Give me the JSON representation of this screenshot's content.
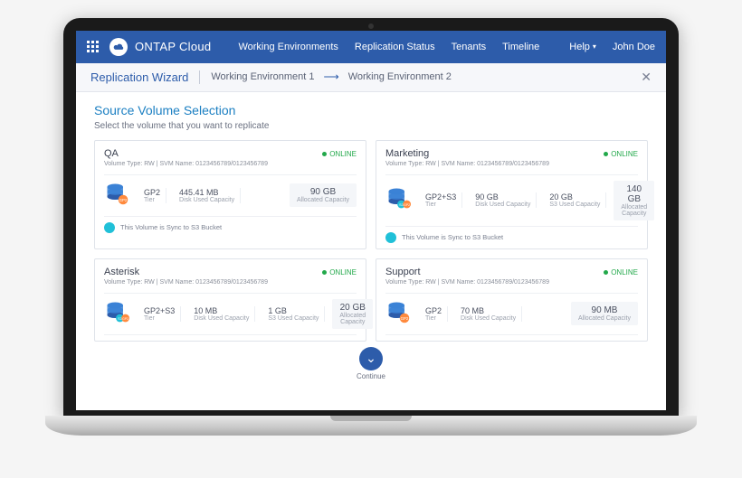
{
  "brand": "ONTAP Cloud",
  "nav": {
    "items": [
      "Working Environments",
      "Replication Status",
      "Tenants",
      "Timeline"
    ],
    "help": "Help",
    "user": "John Doe"
  },
  "wizard": {
    "title": "Replication Wizard",
    "env1": "Working Environment 1",
    "env2": "Working Environment 2"
  },
  "section": {
    "title": "Source Volume Selection",
    "subtitle": "Select the volume that you want to replicate"
  },
  "volumes": [
    {
      "name": "QA",
      "meta": "Volume Type: RW   |   SVM Name: 0123456789/0123456789",
      "status": "ONLINE",
      "tier": "GP2",
      "tier_label": "Tier",
      "metrics": [
        {
          "val": "445.41 MB",
          "lab": "Disk Used Capacity"
        }
      ],
      "alloc": {
        "val": "90 GB",
        "lab": "Allocated Capacity"
      },
      "sync_note": "This Volume is Sync to S3 Bucket"
    },
    {
      "name": "Marketing",
      "meta": "Volume Type: RW   |   SVM Name: 0123456789/0123456789",
      "status": "ONLINE",
      "tier": "GP2+S3",
      "tier_label": "Tier",
      "metrics": [
        {
          "val": "90 GB",
          "lab": "Disk Used Capacity"
        },
        {
          "val": "20 GB",
          "lab": "S3 Used Capacity"
        }
      ],
      "alloc": {
        "val": "140 GB",
        "lab": "Allocated Capacity"
      },
      "sync_note": "This Volume is Sync to S3 Bucket"
    },
    {
      "name": "Asterisk",
      "meta": "Volume Type: RW   |   SVM Name: 0123456789/0123456789",
      "status": "ONLINE",
      "tier": "GP2+S3",
      "tier_label": "Tier",
      "metrics": [
        {
          "val": "10 MB",
          "lab": "Disk Used Capacity"
        },
        {
          "val": "1 GB",
          "lab": "S3 Used Capacity"
        }
      ],
      "alloc": {
        "val": "20 GB",
        "lab": "Allocated Capacity"
      },
      "sync_note": ""
    },
    {
      "name": "Support",
      "meta": "Volume Type: RW   |   SVM Name: 0123456789/0123456789",
      "status": "ONLINE",
      "tier": "GP2",
      "tier_label": "Tier",
      "metrics": [
        {
          "val": "70 MB",
          "lab": "Disk Used Capacity"
        }
      ],
      "alloc": {
        "val": "90 MB",
        "lab": "Allocated Capacity"
      },
      "sync_note": ""
    }
  ],
  "continue_label": "Continue"
}
